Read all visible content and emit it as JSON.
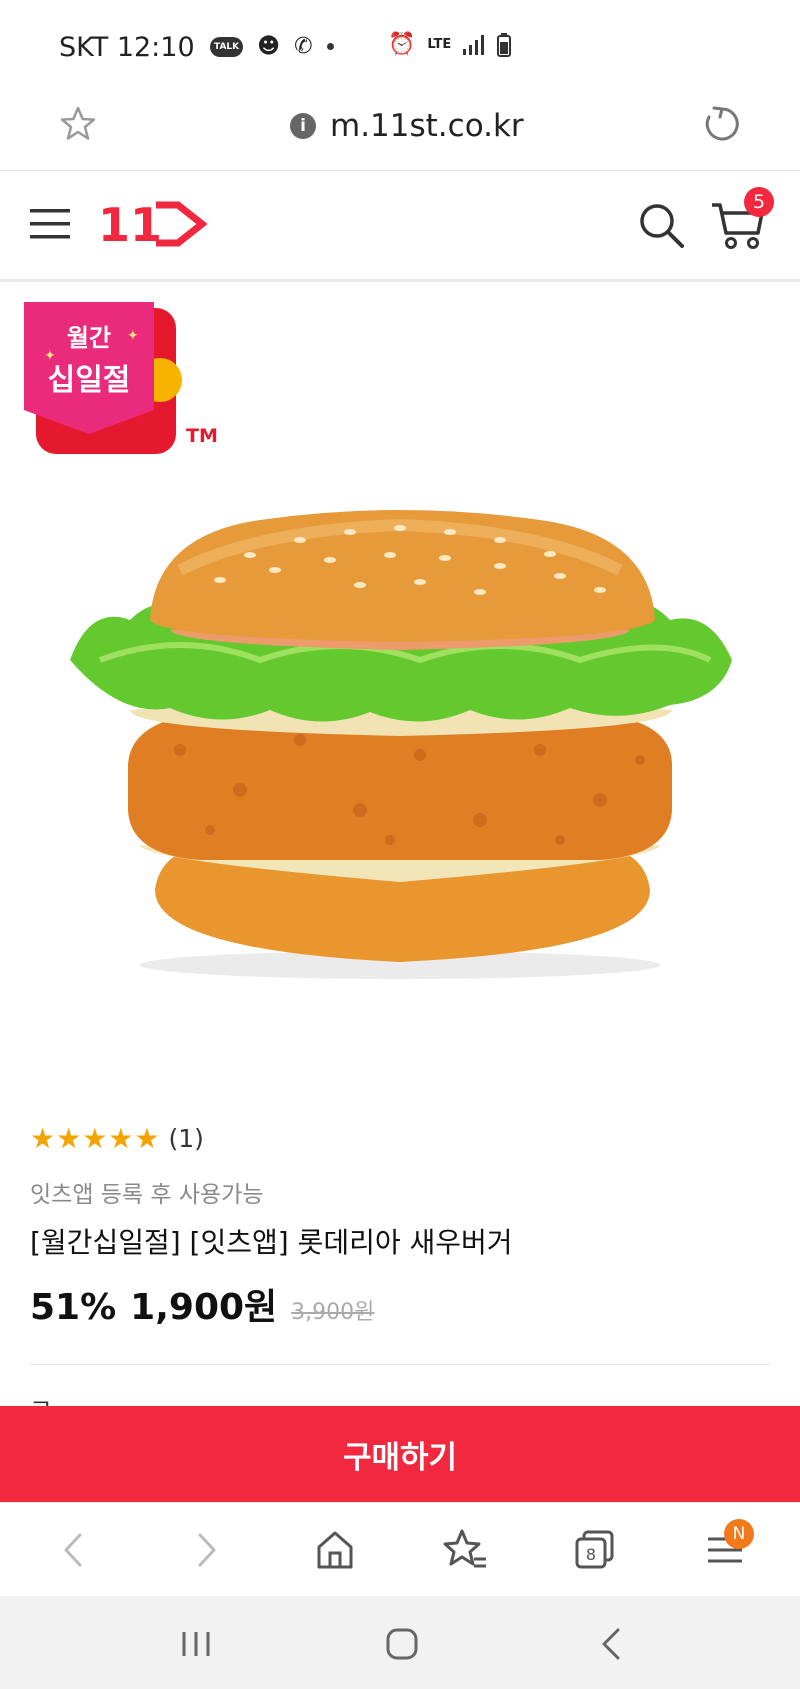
{
  "status_bar": {
    "carrier_time": "SKT 12:10",
    "talk_label": "TALK",
    "lte_label": "LTE"
  },
  "url_bar": {
    "url": "m.11st.co.kr",
    "info_symbol": "i"
  },
  "site_header": {
    "logo_text": "11",
    "cart_count": "5"
  },
  "promo_badge": {
    "line1": "월간",
    "line2": "십일절",
    "tm": "TM"
  },
  "product": {
    "stars": "★★★★★",
    "rating_count": "(1)",
    "note": "잇츠앱 등록 후 사용가능",
    "title": "[월간십일절] [잇츠앱] 롯데리아 새우버거",
    "discount": "51%",
    "price": "1,900원",
    "original_price": "3,900원",
    "peek_text": "구"
  },
  "buy_button": {
    "label": "구매하기"
  },
  "browser_toolbar": {
    "tabs_count": "8",
    "menu_badge": "N"
  },
  "colors": {
    "brand_red": "#f2283e",
    "star": "#f5a300",
    "badge_orange": "#f27a1a"
  }
}
